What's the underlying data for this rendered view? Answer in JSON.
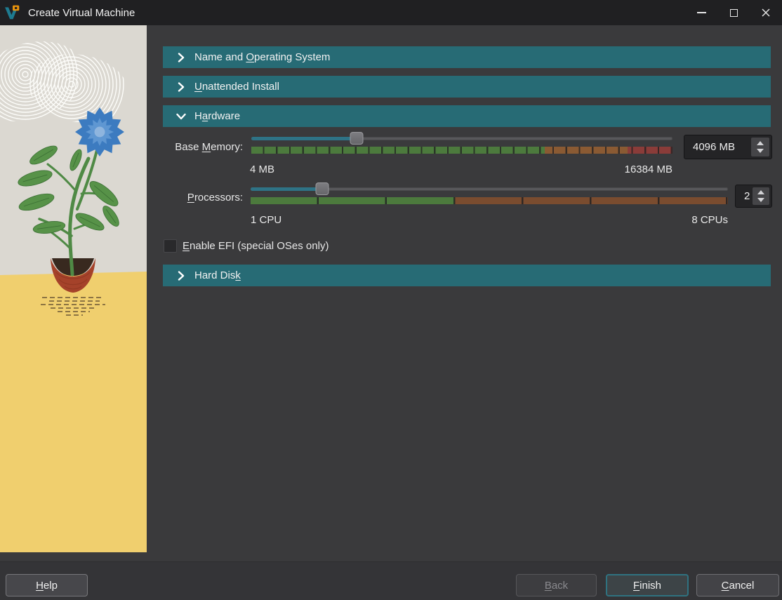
{
  "titlebar": {
    "title": "Create Virtual Machine"
  },
  "colors": {
    "accent_teal": "#276b75",
    "slider_fill": "#2e7386",
    "zone_green": "#4c7a3d",
    "zone_orange": "#8a5a33",
    "zone_red": "#8a3c39",
    "zone_orange_cpu": "#7a4c2f"
  },
  "sections": {
    "name_os": {
      "pre": "Name and ",
      "key": "O",
      "post": "perating System",
      "state": "collapsed"
    },
    "unattended": {
      "pre": "",
      "key": "U",
      "post": "nattended Install",
      "state": "collapsed"
    },
    "hardware": {
      "pre": "H",
      "key": "a",
      "post": "rdware",
      "state": "expanded"
    },
    "hard_disk": {
      "pre": "Hard Dis",
      "key": "k",
      "post": "",
      "state": "collapsed"
    }
  },
  "hardware": {
    "base_memory": {
      "label": {
        "pre": "Base ",
        "key": "M",
        "post": "emory:"
      },
      "min": "4 MB",
      "max": "16384 MB",
      "value": "4096 MB",
      "slider": {
        "value_pct": "25%",
        "green_pct": "69.7%",
        "orange_pct": "19.6%",
        "red_pct": "10.7%"
      }
    },
    "processors": {
      "label": {
        "pre": "",
        "key": "P",
        "post": "rocessors:"
      },
      "min": "1 CPU",
      "max": "8 CPUs",
      "value": "2",
      "slider": {
        "value_pct": "15%",
        "green_pct": "42.8%",
        "orange_pct": "57.2%",
        "red_pct": "0%"
      }
    },
    "efi": {
      "label": {
        "pre": "",
        "key": "E",
        "post": "nable EFI (special OSes only)"
      },
      "checked": false
    }
  },
  "buttons": {
    "help": {
      "pre": "",
      "key": "H",
      "post": "elp"
    },
    "back": {
      "pre": "",
      "key": "B",
      "post": "ack",
      "enabled": false
    },
    "finish": {
      "pre": "",
      "key": "F",
      "post": "inish"
    },
    "cancel": {
      "pre": "",
      "key": "C",
      "post": "ancel"
    }
  }
}
